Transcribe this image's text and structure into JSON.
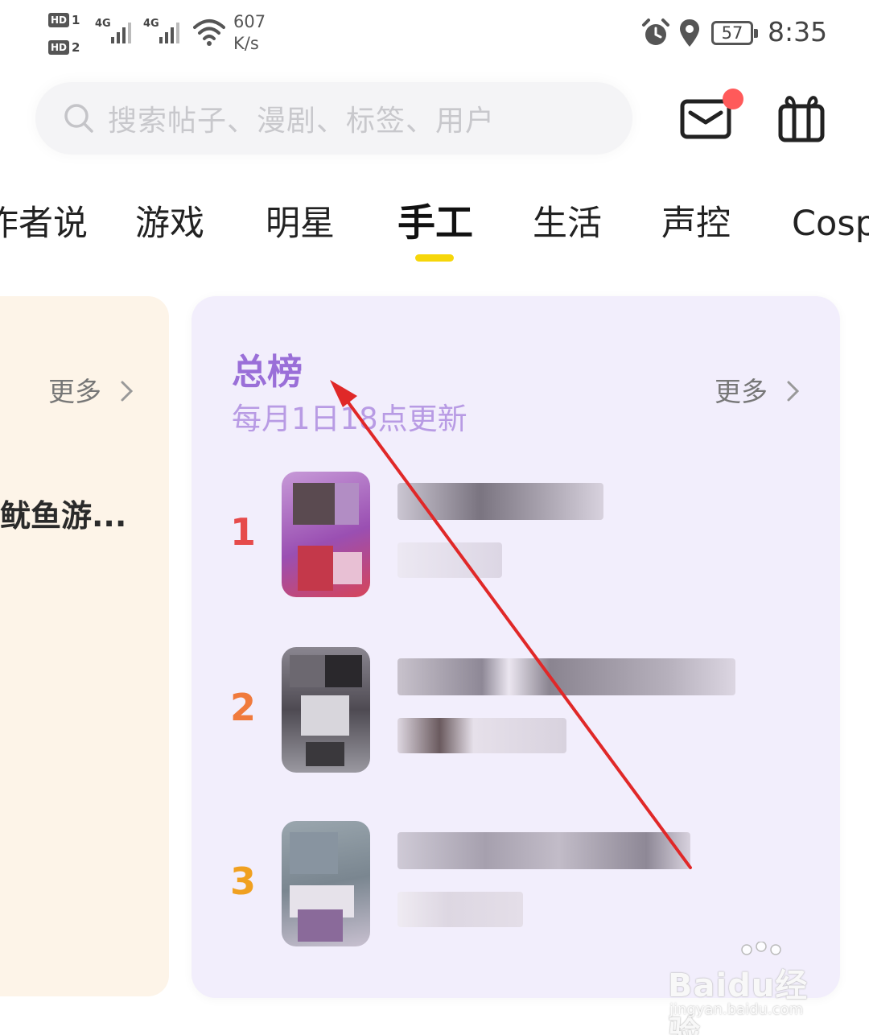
{
  "status_bar": {
    "sim1_label": "HD",
    "sim1_num": "1",
    "sim2_label": "HD",
    "sim2_num": "2",
    "network1": "4G",
    "network2": "4G",
    "speed_value": "607",
    "speed_unit": "K/s",
    "battery": "57",
    "time": "8:35"
  },
  "header": {
    "search_placeholder": "搜索帖子、漫剧、标签、用户",
    "icons": [
      "search-icon",
      "mail-icon",
      "gift-icon"
    ],
    "mail_badge_color": "#ff5a5a"
  },
  "tabs": {
    "items": [
      "作者说",
      "游戏",
      "明星",
      "手工",
      "生活",
      "声控",
      "Cosplay"
    ],
    "active": "手工",
    "indicator_color": "#f6d60a"
  },
  "left_card": {
    "more_label": "更多",
    "item_title": "鱿鱼游..."
  },
  "ranking": {
    "title": "总榜",
    "subtitle": "每月1日18点更新",
    "more_label": "更多",
    "accent_color": "#9a6fd8",
    "items": [
      {
        "rank": "1",
        "rank_color": "#e64b4b"
      },
      {
        "rank": "2",
        "rank_color": "#f07a3c"
      },
      {
        "rank": "3",
        "rank_color": "#f0a020"
      }
    ]
  },
  "watermark": {
    "brand": "Baidu经验",
    "url": "jingyan.baidu.com"
  }
}
